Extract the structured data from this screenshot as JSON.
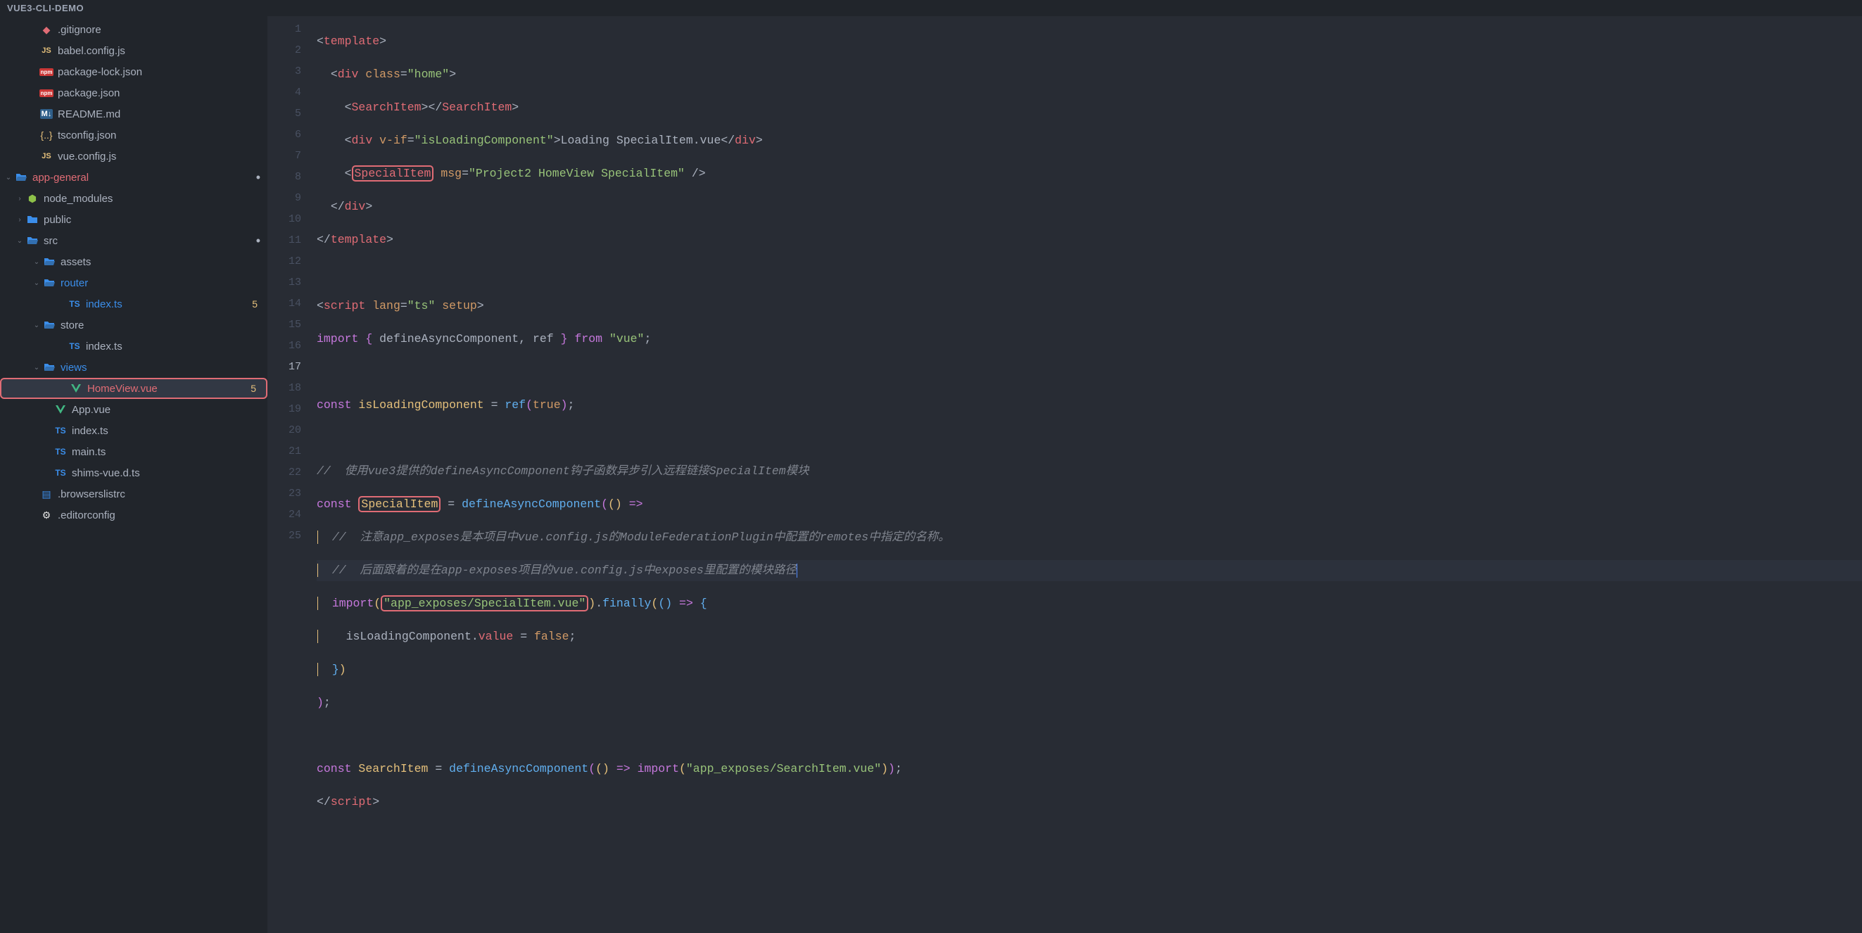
{
  "title": "VUE3-CLI-DEMO",
  "sidebar": {
    "items": [
      {
        "indent": 40,
        "chev": "",
        "icon": "git",
        "label": ".gitignore"
      },
      {
        "indent": 40,
        "chev": "",
        "icon": "js",
        "label": "babel.config.js"
      },
      {
        "indent": 40,
        "chev": "",
        "icon": "npm",
        "label": "package-lock.json"
      },
      {
        "indent": 40,
        "chev": "",
        "icon": "npm",
        "label": "package.json"
      },
      {
        "indent": 40,
        "chev": "",
        "icon": "md",
        "label": "README.md"
      },
      {
        "indent": 40,
        "chev": "",
        "icon": "json",
        "label": "tsconfig.json"
      },
      {
        "indent": 40,
        "chev": "",
        "icon": "js",
        "label": "vue.config.js"
      },
      {
        "indent": 4,
        "chev": "⌄",
        "icon": "folder-open",
        "label": "app-general",
        "cls": "folder-app",
        "dot": true
      },
      {
        "indent": 20,
        "chev": "›",
        "icon": "nm",
        "label": "node_modules"
      },
      {
        "indent": 20,
        "chev": "›",
        "icon": "folder",
        "label": "public"
      },
      {
        "indent": 20,
        "chev": "⌄",
        "icon": "folder-open",
        "label": "src",
        "cls": "folder-src",
        "dot": true
      },
      {
        "indent": 44,
        "chev": "⌄",
        "icon": "folder-open",
        "label": "assets"
      },
      {
        "indent": 44,
        "chev": "⌄",
        "icon": "folder-open",
        "label": "router",
        "cls": "folder-router"
      },
      {
        "indent": 80,
        "chev": "",
        "icon": "ts",
        "label": "index.ts",
        "cls": "file-index-router",
        "badge": "5"
      },
      {
        "indent": 44,
        "chev": "⌄",
        "icon": "folder-open",
        "label": "store"
      },
      {
        "indent": 80,
        "chev": "",
        "icon": "ts",
        "label": "index.ts"
      },
      {
        "indent": 44,
        "chev": "⌄",
        "icon": "folder-open",
        "label": "views",
        "cls": "folder-views"
      },
      {
        "indent": 80,
        "chev": "",
        "icon": "vue",
        "label": "HomeView.vue",
        "cls": "file-homeview",
        "badge": "5",
        "highlighted": true,
        "selected": true
      },
      {
        "indent": 60,
        "chev": "",
        "icon": "vue",
        "label": "App.vue"
      },
      {
        "indent": 60,
        "chev": "",
        "icon": "ts",
        "label": "index.ts"
      },
      {
        "indent": 60,
        "chev": "",
        "icon": "ts",
        "label": "main.ts"
      },
      {
        "indent": 60,
        "chev": "",
        "icon": "ts",
        "label": "shims-vue.d.ts"
      },
      {
        "indent": 40,
        "chev": "",
        "icon": "browserslist",
        "label": ".browserslistrc"
      },
      {
        "indent": 40,
        "chev": "",
        "icon": "ed",
        "label": ".editorconfig"
      }
    ]
  },
  "code": {
    "l1_template": "template",
    "l2_div": "div",
    "l2_class": "class",
    "l2_home": "\"home\"",
    "l3_searchitem": "SearchItem",
    "l4_div": "div",
    "l4_vif": "v-if",
    "l4_cond": "\"isLoadingComponent\"",
    "l4_text": "Loading SpecialItem.vue",
    "l5_si": "SpecialItem",
    "l5_msg": "msg",
    "l5_val": "\"Project2 HomeView SpecialItem\"",
    "l6_div": "div",
    "l7_template": "template",
    "l9_script": "script",
    "l9_lang": "lang",
    "l9_ts": "\"ts\"",
    "l9_setup": "setup",
    "l10_import": "import",
    "l10_dac": "defineAsyncComponent",
    "l10_ref": "ref",
    "l10_from": "from",
    "l10_vue": "\"vue\"",
    "l12_const": "const",
    "l12_var": "isLoadingComponent",
    "l12_ref": "ref",
    "l12_true": "true",
    "l14_comment": "//  使用vue3提供的defineAsyncComponent钩子函数异步引入远程链接SpecialItem模块",
    "l15_const": "const",
    "l15_si": "SpecialItem",
    "l15_dac": "defineAsyncComponent",
    "l16_comment": "//  注意app_exposes是本项目中vue.config.js的ModuleFederationPlugin中配置的remotes中指定的名称。",
    "l17_comment": "//  后面跟着的是在app-exposes项目的vue.config.js中exposes里配置的模块路径",
    "l18_import": "import",
    "l18_path": "\"app_exposes/SpecialItem.vue\"",
    "l18_finally": "finally",
    "l19_var": "isLoadingComponent",
    "l19_value": "value",
    "l19_false": "false",
    "l23_const": "const",
    "l23_si": "SearchItem",
    "l23_dac": "defineAsyncComponent",
    "l23_import": "import",
    "l23_path": "\"app_exposes/SearchItem.vue\"",
    "l24_script": "script"
  }
}
